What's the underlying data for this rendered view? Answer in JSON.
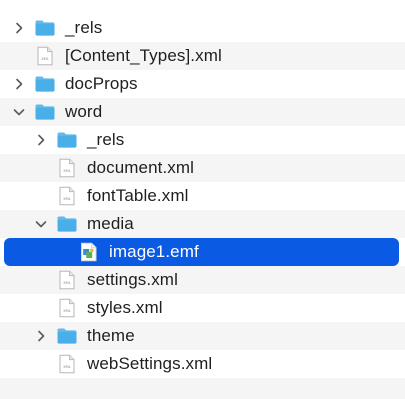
{
  "tree": {
    "items": [
      {
        "label": "_rels",
        "kind": "folder",
        "depth": 0,
        "expanded": false,
        "has_children": true,
        "icon": "folder-icon",
        "selected": false
      },
      {
        "label": "[Content_Types].xml",
        "kind": "xml-file",
        "depth": 0,
        "has_children": false,
        "icon": "xml-file-icon",
        "selected": false
      },
      {
        "label": "docProps",
        "kind": "folder",
        "depth": 0,
        "expanded": false,
        "has_children": true,
        "icon": "folder-icon",
        "selected": false
      },
      {
        "label": "word",
        "kind": "folder",
        "depth": 0,
        "expanded": true,
        "has_children": true,
        "icon": "folder-icon",
        "selected": false
      },
      {
        "label": "_rels",
        "kind": "folder",
        "depth": 1,
        "expanded": false,
        "has_children": true,
        "icon": "folder-icon",
        "selected": false
      },
      {
        "label": "document.xml",
        "kind": "xml-file",
        "depth": 1,
        "has_children": false,
        "icon": "xml-file-icon",
        "selected": false
      },
      {
        "label": "fontTable.xml",
        "kind": "xml-file",
        "depth": 1,
        "has_children": false,
        "icon": "xml-file-icon",
        "selected": false
      },
      {
        "label": "media",
        "kind": "folder",
        "depth": 1,
        "expanded": true,
        "has_children": true,
        "icon": "folder-icon",
        "selected": false
      },
      {
        "label": "image1.emf",
        "kind": "emf-file",
        "depth": 2,
        "has_children": false,
        "icon": "emf-image-file-icon",
        "selected": true
      },
      {
        "label": "settings.xml",
        "kind": "xml-file",
        "depth": 1,
        "has_children": false,
        "icon": "xml-file-icon",
        "selected": false
      },
      {
        "label": "styles.xml",
        "kind": "xml-file",
        "depth": 1,
        "has_children": false,
        "icon": "xml-file-icon",
        "selected": false
      },
      {
        "label": "theme",
        "kind": "folder",
        "depth": 1,
        "expanded": false,
        "has_children": true,
        "icon": "folder-icon",
        "selected": false
      },
      {
        "label": "webSettings.xml",
        "kind": "xml-file",
        "depth": 1,
        "has_children": false,
        "icon": "xml-file-icon",
        "selected": false
      }
    ]
  },
  "colors": {
    "folder": "#4aaee8",
    "selection": "#0b5ae3",
    "alt_row": "#f5f5f5",
    "text": "#1f1f1f"
  }
}
